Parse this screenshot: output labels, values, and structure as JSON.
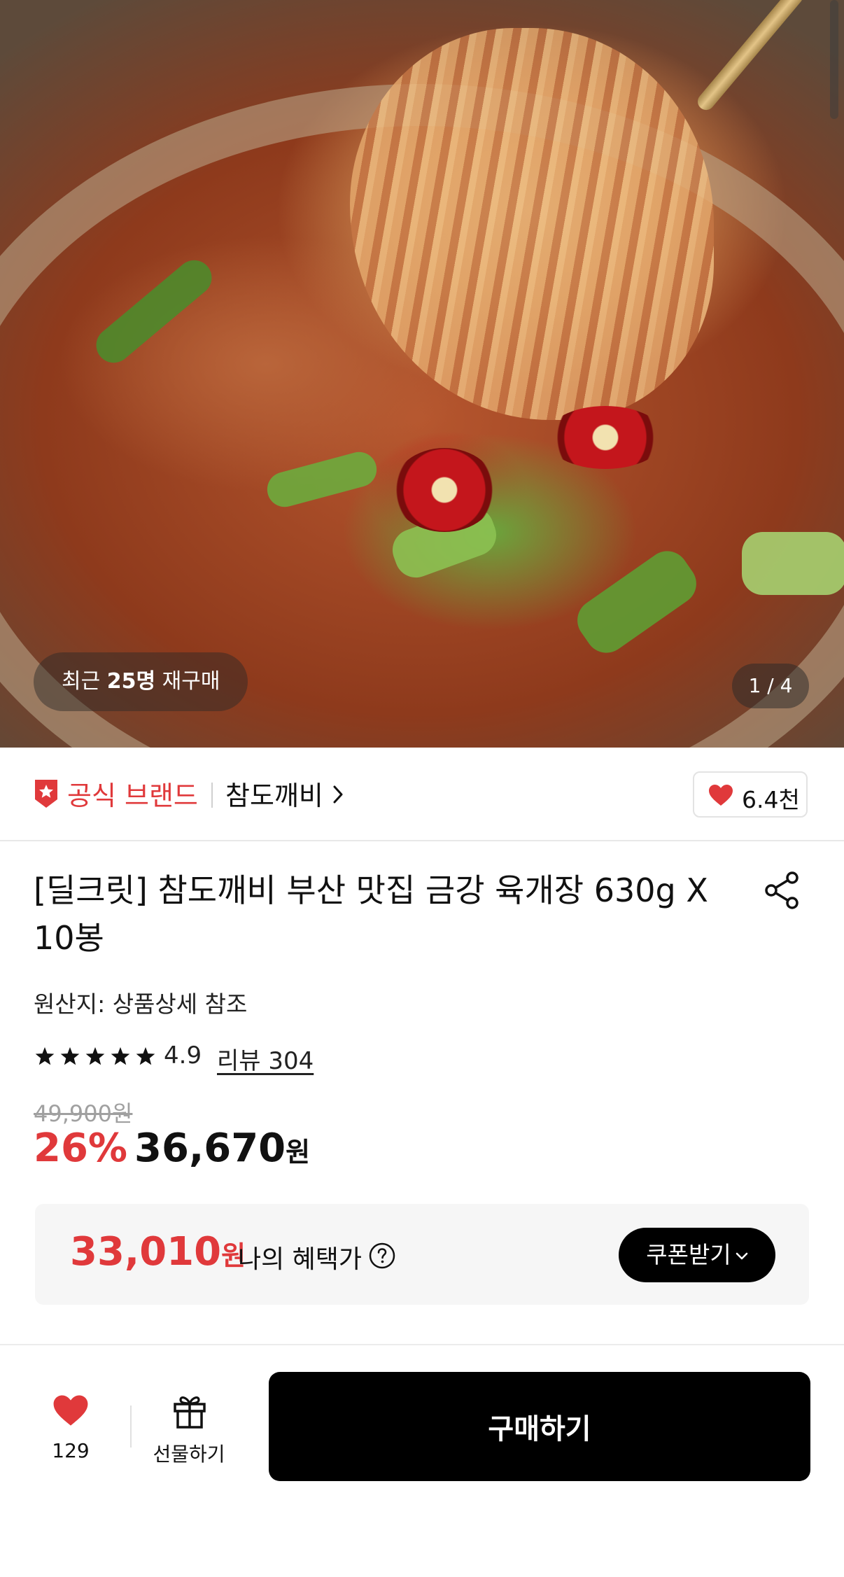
{
  "hero": {
    "repurchase_prefix": "최근",
    "repurchase_count": "25명",
    "repurchase_suffix": "재구매",
    "page_indicator": "1 / 4"
  },
  "brand": {
    "official_label": "공식 브랜드",
    "name": "참도깨비",
    "like_count": "6.4천"
  },
  "product": {
    "title": "[딜크릿] 참도깨비 부산 맛집 금강 육개장 630g X 10봉",
    "origin": "원산지: 상품상세 참조",
    "rating": "4.9",
    "star_count": 5,
    "review_link": "리뷰 304",
    "original_price": "49,900원",
    "discount_rate": "26%",
    "sale_price": "36,670",
    "currency": "원"
  },
  "benefit": {
    "price": "33,010",
    "currency": "원",
    "label": "나의 혜택가",
    "coupon_button": "쿠폰받기"
  },
  "bottom_bar": {
    "wish_count": "129",
    "gift_label": "선물하기",
    "buy_button": "구매하기"
  },
  "colors": {
    "accent_red": "#e0393b",
    "button_black": "#000000",
    "benefit_bg": "#f6f6f6"
  },
  "icons": [
    "official-brand-star-icon",
    "chevron-right-icon",
    "heart-icon",
    "share-icon",
    "star-icon",
    "help-circle-icon",
    "chevron-down-icon",
    "gift-icon"
  ]
}
